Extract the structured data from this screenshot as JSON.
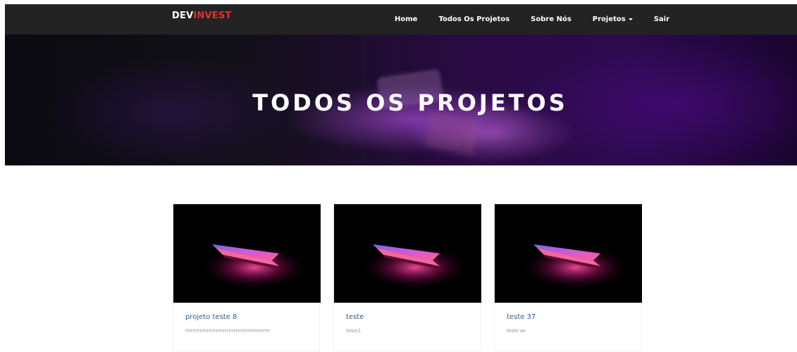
{
  "brand": {
    "part1": "DEV",
    "part2": "INVEST",
    "colors": {
      "part1": "#ffffff",
      "part2": "#e03131"
    }
  },
  "nav": {
    "items": [
      {
        "label": "Home"
      },
      {
        "label": "Todos Os Projetos"
      },
      {
        "label": "Sobre Nós"
      },
      {
        "label": "Projetos"
      },
      {
        "label": "Sair"
      }
    ]
  },
  "hero": {
    "title": "TODOS OS PROJETOS"
  },
  "projects": [
    {
      "title": "projeto teste 8",
      "description": "rrrrrrrrrrrrrrrrrrrrrrrrrrrrrrrrrrrrrrrrrrrrrrr"
    },
    {
      "title": "teste",
      "description": "teste1"
    },
    {
      "title": "teste 37",
      "description": "teste wr"
    }
  ]
}
